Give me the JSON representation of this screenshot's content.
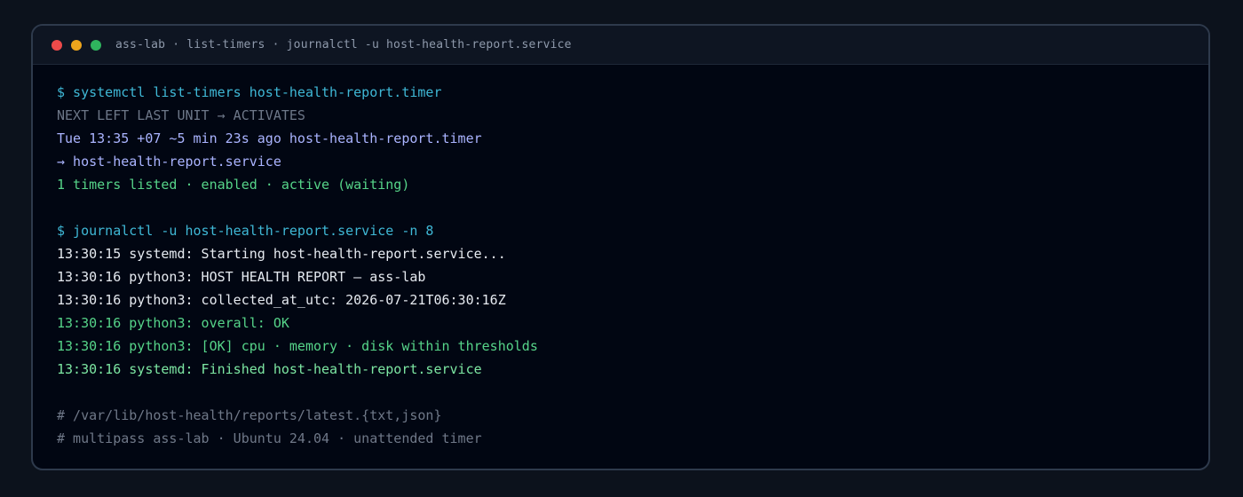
{
  "window": {
    "title": "ass-lab · list-timers · journalctl -u host-health-report.service",
    "controls": {
      "close_color": "#ed4a4a",
      "minimize_color": "#eea51c",
      "maximize_color": "#2fb45e"
    }
  },
  "terminal": {
    "timers": {
      "command": "$ systemctl list-timers host-health-report.timer",
      "header": "NEXT LEFT LAST UNIT → ACTIVATES",
      "row": "Tue 13:35 +07 ~5 min 23s ago host-health-report.timer",
      "activates": "→ host-health-report.service",
      "status": "1 timers listed · enabled · active (waiting)"
    },
    "journal": {
      "command": "$ journalctl -u host-health-report.service -n 8",
      "lines": [
        "13:30:15 systemd: Starting host-health-report.service...",
        "13:30:16 python3: HOST HEALTH REPORT — ass-lab",
        "13:30:16 python3: collected_at_utc: 2026-07-21T06:30:16Z",
        "13:30:16 python3: overall: OK",
        "13:30:16 python3: [OK] cpu · memory · disk within thresholds",
        "13:30:16 systemd: Finished host-health-report.service"
      ]
    },
    "comments": [
      "# /var/lib/host-health/reports/latest.{txt,json}",
      "# multipass ass-lab · Ubuntu 24.04 · unattended timer"
    ]
  }
}
